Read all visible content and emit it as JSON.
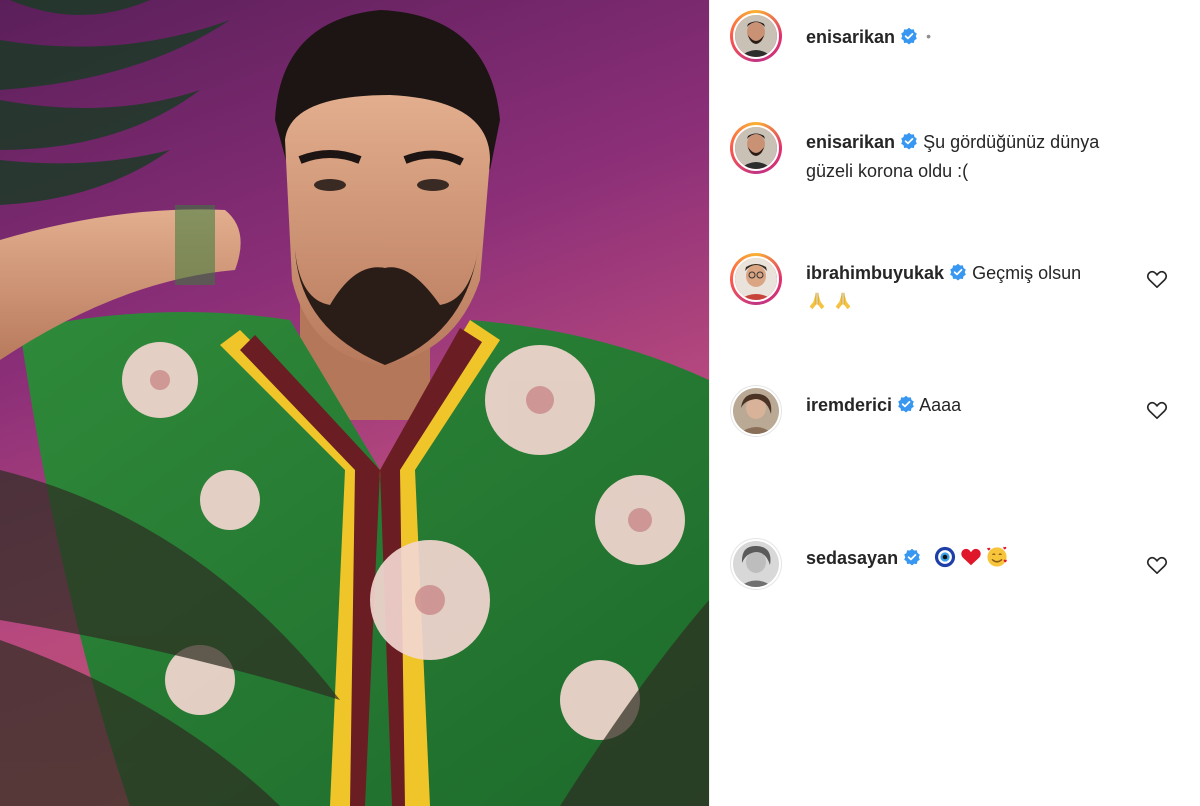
{
  "post": {
    "author": "enisarikan",
    "author_dot": "•",
    "caption": "Şu gördüğünüz dünya güzeli korona oldu :("
  },
  "comments": [
    {
      "username": "ibrahimbuyukak",
      "text": "Geçmiş olsun",
      "emojis": [
        "folded-hands",
        "folded-hands"
      ],
      "liked": false
    },
    {
      "username": "iremderici",
      "text": "Aaaa",
      "emojis": [],
      "liked": false
    },
    {
      "username": "sedasayan",
      "text": "",
      "emojis": [
        "nazar-amulet",
        "red-heart",
        "smiling-face-with-hearts"
      ],
      "liked": false
    }
  ],
  "colors": {
    "verified": "#3897f0",
    "text": "#262626",
    "story_ring": [
      "#f9b233",
      "#e1306c",
      "#c13584"
    ]
  }
}
